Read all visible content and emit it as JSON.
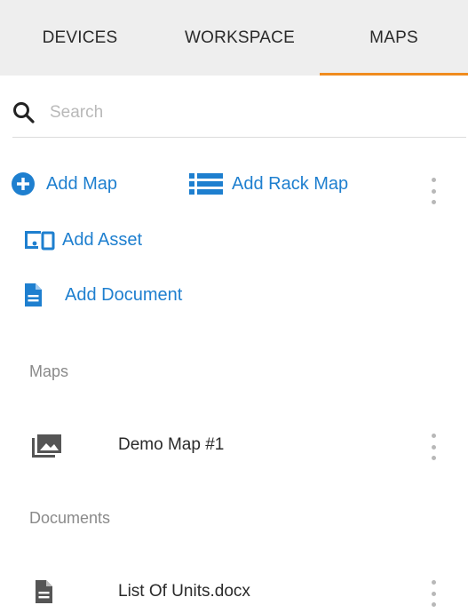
{
  "tabs": [
    {
      "label": "DEVICES",
      "active": false
    },
    {
      "label": "WORKSPACE",
      "active": false
    },
    {
      "label": "MAPS",
      "active": true
    }
  ],
  "search": {
    "placeholder": "Search",
    "value": ""
  },
  "actions": {
    "add_map": "Add Map",
    "add_rack_map": "Add Rack Map",
    "add_asset": "Add Asset",
    "add_document": "Add Document"
  },
  "sections": {
    "maps": {
      "title": "Maps",
      "items": [
        {
          "label": "Demo Map #1",
          "icon": "image-icon"
        }
      ]
    },
    "documents": {
      "title": "Documents",
      "items": [
        {
          "label": "List Of Units.docx",
          "icon": "document-icon"
        }
      ]
    }
  },
  "colors": {
    "accent": "#1e7fcf",
    "tab_indicator": "#f08c1e",
    "muted": "#8a8a8a"
  }
}
